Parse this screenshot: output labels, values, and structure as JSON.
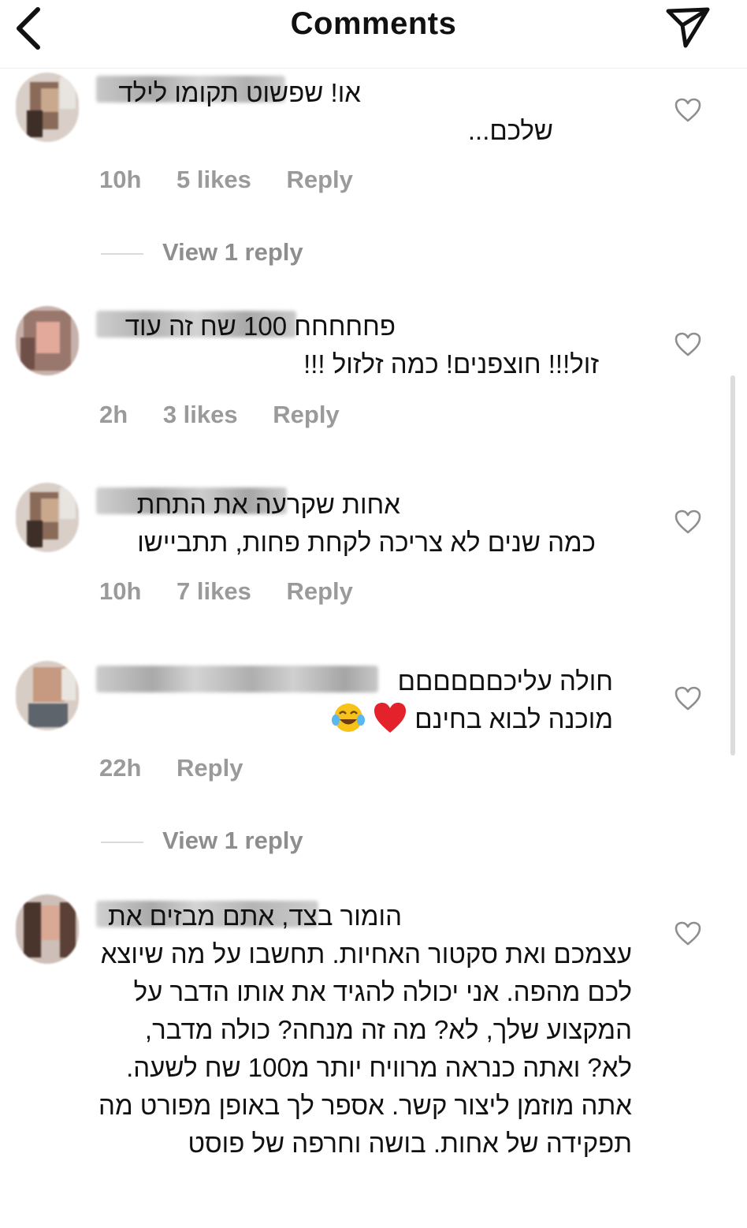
{
  "header": {
    "title": "Comments",
    "back_icon": "chevron-left-icon",
    "share_icon": "paper-plane-icon"
  },
  "comments": [
    {
      "text": "או! שפשוט תקומו לילד שלכם...",
      "time": "10h",
      "likes": "5 likes",
      "reply": "Reply",
      "view_replies": "View 1 reply"
    },
    {
      "text": "פחחחחח 100 שח זה עוד זול!!! חוצפנים! כמה זלזול !!!",
      "time": "2h",
      "likes": "3 likes",
      "reply": "Reply"
    },
    {
      "text": "אחות שקרעה את התחת כמה שנים לא צריכה לקחת פחות, תתביישו",
      "time": "10h",
      "likes": "7 likes",
      "reply": "Reply"
    },
    {
      "text": "חולה עליכםםםםםם",
      "text_line2": "מוכנה לבוא בחינם",
      "emojis": [
        "face-with-tears-of-joy-icon",
        "red-heart-icon"
      ],
      "time": "22h",
      "reply": "Reply",
      "view_replies": "View 1 reply"
    },
    {
      "text": "הומור בצד, אתם מבזים את עצמכם ואת סקטור האחיות. תחשבו על מה שיוצא לכם מהפה. אני יכולה להגיד את אותו הדבר על המקצוע שלך, לא? מה זה מנחה? כולה מדבר, לא? ואתה כנראה מרוויח יותר מ100 שח לשעה. אתה מוזמן ליצור קשר. אספר לך באופן מפורט מה תפקידה של אחות. בושה וחרפה של פוסט"
    }
  ],
  "colors": {
    "text": "#111111",
    "meta": "#9a9a9a",
    "divider": "#efefef",
    "scrollbar": "#dcdcdc"
  }
}
